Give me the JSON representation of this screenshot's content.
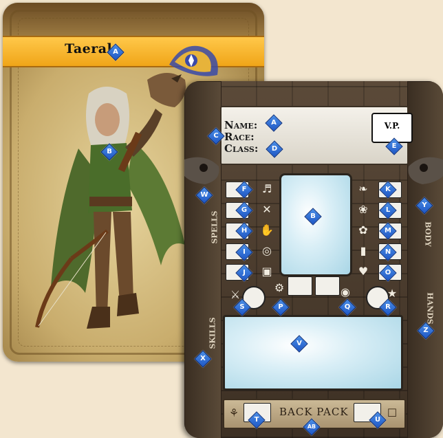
{
  "hero": {
    "name": "Taeral"
  },
  "board": {
    "name_label": "Name:",
    "race_label": "Race:",
    "class_label": "Class:",
    "vp_label": "V.P.",
    "backpack_label": "BACK PACK",
    "spells_label": "SPELLS",
    "body_label": "BODY",
    "skills_label": "SKILLS",
    "hands_label": "HANDS"
  },
  "markers": {
    "A": "A",
    "B": "B",
    "C": "C",
    "D": "D",
    "E": "E",
    "F": "F",
    "G": "G",
    "H": "H",
    "I": "I",
    "J": "J",
    "K": "K",
    "L": "L",
    "M": "M",
    "N": "N",
    "O": "O",
    "P": "P",
    "Q": "Q",
    "R": "R",
    "S": "S",
    "T": "T",
    "U": "U",
    "V": "V",
    "W": "W",
    "X": "X",
    "Y": "Y",
    "Z": "Z",
    "AB": "AB"
  },
  "colors": {
    "banner": "#f5b021",
    "marker": "#2b6fd6",
    "panel": "#bfe3ef"
  },
  "icons": [
    "boot-icon",
    "crossed-swords-icon",
    "fist-icon",
    "target-icon",
    "gifts-icon",
    "wing-icon",
    "brain-icon",
    "swirl-icon",
    "banner-icon",
    "heart-pulse-icon",
    "sword-icon",
    "gear-icon",
    "amulet-icon",
    "star-icon",
    "pouch-icon",
    "bag-icon"
  ]
}
